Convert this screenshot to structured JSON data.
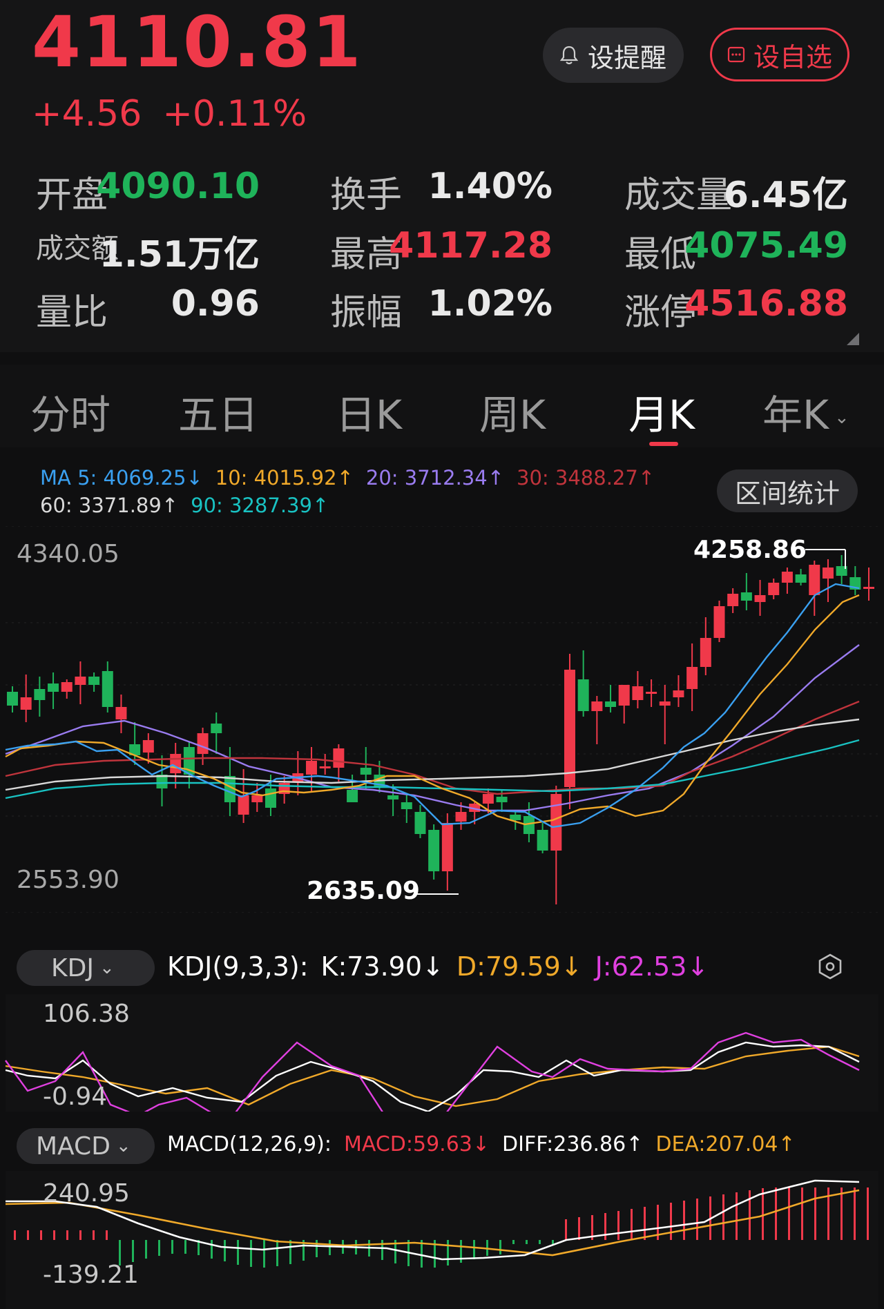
{
  "quote": {
    "price": "4110.81",
    "change": "+4.56",
    "change_pct": "+0.11%"
  },
  "buttons": {
    "remind": "设提醒",
    "watchlist": "设自选",
    "range_stats": "区间统计"
  },
  "stats": {
    "open_label": "开盘",
    "open": "4090.10",
    "turnover_label": "换手",
    "turnover": "1.40%",
    "volume_label": "成交量",
    "volume": "6.45亿",
    "amount_label": "成交额",
    "amount": "1.51万亿",
    "high_label": "最高",
    "high": "4117.28",
    "low_label": "最低",
    "low": "4075.49",
    "vol_ratio_label": "量比",
    "vol_ratio": "0.96",
    "amplitude_label": "振幅",
    "amplitude": "1.02%",
    "limit_up_label": "涨停",
    "limit_up": "4516.88"
  },
  "tabs": [
    {
      "label": "分时"
    },
    {
      "label": "五日"
    },
    {
      "label": "日K"
    },
    {
      "label": "周K"
    },
    {
      "label": "月K",
      "active": true
    },
    {
      "label": "年K"
    }
  ],
  "ma_legend": {
    "ma5": "MA 5: 4069.25↓",
    "ma10": "10: 4015.92↑",
    "ma20": "20: 3712.34↑",
    "ma30": "30: 3488.27↑",
    "ma60": "60: 3371.89↑",
    "ma90": "90: 3287.39↑"
  },
  "colors": {
    "up": "#f0394a",
    "down": "#1fb35a",
    "ma5": "#3aa0f0",
    "ma10": "#f0a92a",
    "ma20": "#9a7cf0",
    "ma30": "#c0343c",
    "ma60": "#d9d9d9",
    "ma90": "#19c2c2",
    "kdj_k": "#ffffff",
    "kdj_d": "#f0a92a",
    "kdj_j": "#e040e0"
  },
  "main_chart": {
    "axis_top": "4340.05",
    "axis_bottom": "2553.90",
    "marker_high": "4258.86",
    "marker_low": "2635.09"
  },
  "kdj": {
    "name": "KDJ",
    "params": "KDJ(9,3,3):",
    "k": "K:73.90↓",
    "d": "D:79.59↓",
    "j": "J:62.53↓",
    "axis_top": "106.38",
    "axis_bottom": "-0.94"
  },
  "macd": {
    "name": "MACD",
    "params": "MACD(12,26,9):",
    "macd": "MACD:59.63↓",
    "diff": "DIFF:236.86↑",
    "dea": "DEA:207.04↑",
    "axis_top": "240.95",
    "axis_bottom": "-139.21"
  }
}
